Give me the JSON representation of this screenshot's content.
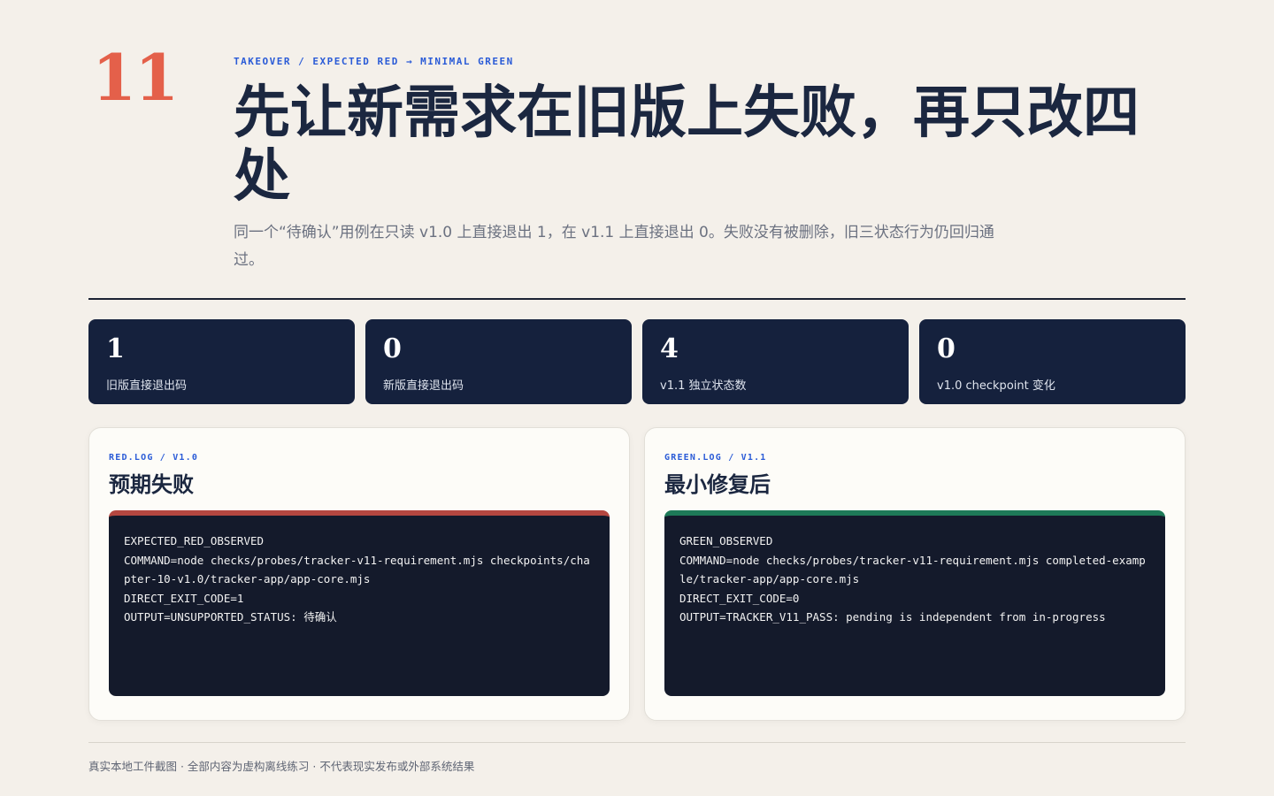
{
  "slide": {
    "number": "11",
    "kicker": "TAKEOVER / EXPECTED RED → MINIMAL GREEN",
    "title": "先让新需求在旧版上失败，再只改四处",
    "subtitle": "同一个“待确认”用例在只读 v1.0 上直接退出 1，在 v1.1 上直接退出 0。失败没有被删除，旧三状态行为仍回归通过。"
  },
  "stats": [
    {
      "value": "1",
      "label": "旧版直接退出码"
    },
    {
      "value": "0",
      "label": "新版直接退出码"
    },
    {
      "value": "4",
      "label": "v1.1 独立状态数"
    },
    {
      "value": "0",
      "label": "v1.0 checkpoint 变化"
    }
  ],
  "panels": {
    "red": {
      "kicker": "RED.LOG / V1.0",
      "title": "预期失败",
      "log": "EXPECTED_RED_OBSERVED\nCOMMAND=node checks/probes/tracker-v11-requirement.mjs checkpoints/chapter-10-v1.0/tracker-app/app-core.mjs\nDIRECT_EXIT_CODE=1\nOUTPUT=UNSUPPORTED_STATUS: 待确认",
      "accent": "#b54740"
    },
    "green": {
      "kicker": "GREEN.LOG / V1.1",
      "title": "最小修复后",
      "log": "GREEN_OBSERVED\nCOMMAND=node checks/probes/tracker-v11-requirement.mjs completed-example/tracker-app/app-core.mjs\nDIRECT_EXIT_CODE=0\nOUTPUT=TRACKER_V11_PASS: pending is independent from in-progress",
      "accent": "#1e7a58"
    }
  },
  "footer": "真实本地工件截图 · 全部内容为虚构离线练习 · 不代表现实发布或外部系统结果"
}
